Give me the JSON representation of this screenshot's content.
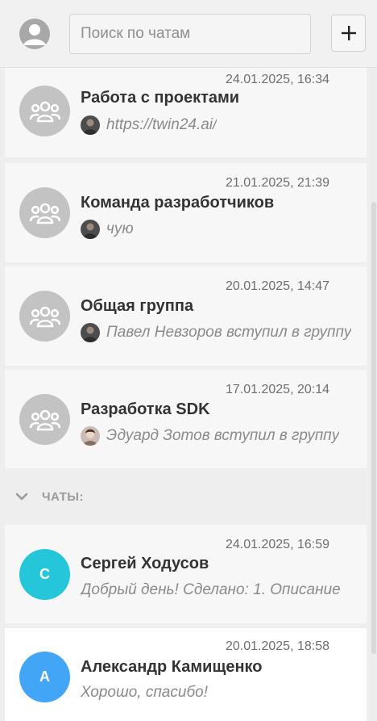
{
  "header": {
    "search_placeholder": "Поиск по чатам",
    "add_button_label": "+"
  },
  "groups": [
    {
      "title": "Работа с проектами",
      "timestamp": "24.01.2025, 16:34",
      "preview": "https://twin24.ai/",
      "sender_avatar": "dark"
    },
    {
      "title": "Команда разработчиков",
      "timestamp": "21.01.2025, 21:39",
      "preview": "чую",
      "sender_avatar": "dark"
    },
    {
      "title": "Общая группа",
      "timestamp": "20.01.2025, 14:47",
      "preview": "Павел Невзоров вступил в группу",
      "sender_avatar": "dark"
    },
    {
      "title": "Разработка SDK",
      "timestamp": "17.01.2025, 20:14",
      "preview": "Эдуард Зотов вступил в группу",
      "sender_avatar": "light"
    }
  ],
  "chats_section": {
    "label": "ЧАТЫ:"
  },
  "chats": [
    {
      "title": "Сергей Ходусов",
      "timestamp": "24.01.2025, 16:59",
      "preview": "Добрый день! Сделано: 1. Описание",
      "initial": "С",
      "color": "#26c6da"
    },
    {
      "title": "Александр Камищенко",
      "timestamp": "20.01.2025, 18:58",
      "preview": "Хорошо, спасибо!",
      "initial": "А",
      "color": "#42a5f5",
      "selected": true
    }
  ],
  "colors": {
    "background": "#eeeeee",
    "card": "#f7f7f7",
    "selected_card": "#ffffff",
    "group_avatar": "#c3c3c3"
  }
}
